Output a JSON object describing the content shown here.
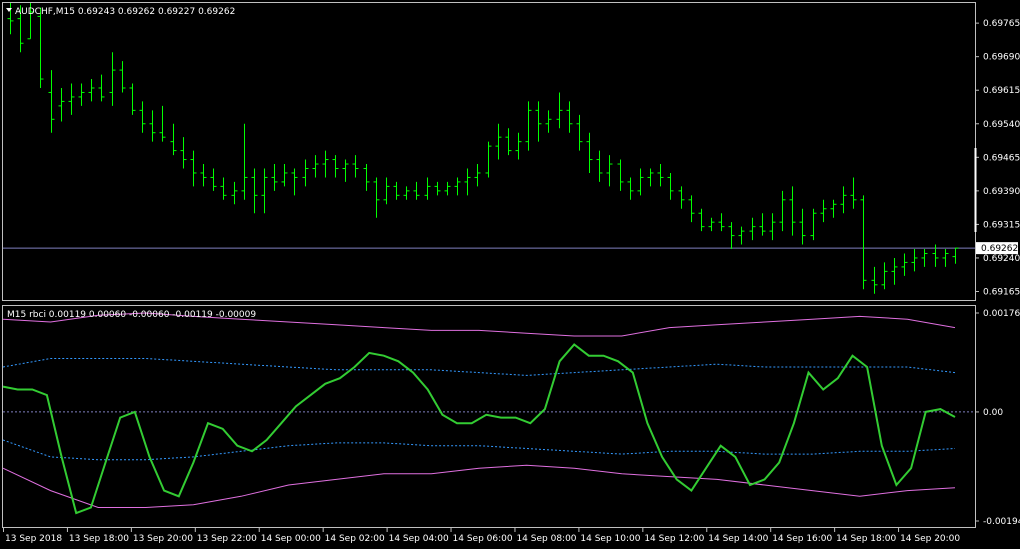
{
  "chart_data": [
    {
      "type": "ohlc",
      "title": "AUDCHF,M15  0.69243 0.69262 0.69227 0.69262",
      "symbol": "AUDCHF",
      "timeframe": "M15",
      "ohlc_header": [
        "0.69243",
        "0.69262",
        "0.69227",
        "0.69262"
      ],
      "ylim": [
        0.69146,
        0.6981
      ],
      "y_ticks": [
        "0.69765",
        "0.69690",
        "0.69615",
        "0.69540",
        "0.69465",
        "0.69390",
        "0.69315",
        "0.69240",
        "0.69165"
      ],
      "current_price": "0.69262",
      "current_price_value": 0.69262,
      "bar_color": "#00ff00",
      "price_line_color": "#8080c0",
      "bars": [
        [
          0.69775,
          0.6981,
          0.6974,
          0.6977
        ],
        [
          0.69775,
          0.69805,
          0.697,
          0.6972
        ],
        [
          0.6973,
          0.6981,
          0.6973,
          0.6979
        ],
        [
          0.6978,
          0.698,
          0.6962,
          0.6964
        ],
        [
          0.6961,
          0.6966,
          0.6952,
          0.6955
        ],
        [
          0.6958,
          0.6962,
          0.69545,
          0.6959
        ],
        [
          0.6959,
          0.6963,
          0.6956,
          0.696
        ],
        [
          0.696,
          0.6963,
          0.6958,
          0.6961
        ],
        [
          0.6961,
          0.6964,
          0.6959,
          0.6962
        ],
        [
          0.6962,
          0.6965,
          0.6959,
          0.696
        ],
        [
          0.6961,
          0.697,
          0.6958,
          0.6966
        ],
        [
          0.6966,
          0.6968,
          0.6961,
          0.6962
        ],
        [
          0.6962,
          0.6963,
          0.6956,
          0.6957
        ],
        [
          0.6957,
          0.6959,
          0.6952,
          0.6954
        ],
        [
          0.6954,
          0.6957,
          0.695,
          0.6952
        ],
        [
          0.6952,
          0.6958,
          0.695,
          0.6951
        ],
        [
          0.695,
          0.6954,
          0.6947,
          0.6948
        ],
        [
          0.6948,
          0.6951,
          0.6944,
          0.6946
        ],
        [
          0.6946,
          0.6948,
          0.694,
          0.6943
        ],
        [
          0.6943,
          0.6945,
          0.694,
          0.6942
        ],
        [
          0.6942,
          0.6944,
          0.6939,
          0.694
        ],
        [
          0.694,
          0.6942,
          0.6937,
          0.6938
        ],
        [
          0.6938,
          0.6941,
          0.6936,
          0.6939
        ],
        [
          0.6939,
          0.6954,
          0.6937,
          0.6942
        ],
        [
          0.6942,
          0.6944,
          0.6934,
          0.6938
        ],
        [
          0.6938,
          0.6944,
          0.6934,
          0.6942
        ],
        [
          0.6942,
          0.6945,
          0.6939,
          0.6941
        ],
        [
          0.6941,
          0.6945,
          0.694,
          0.6943
        ],
        [
          0.6943,
          0.6944,
          0.6938,
          0.6942
        ],
        [
          0.6942,
          0.6946,
          0.694,
          0.6944
        ],
        [
          0.6944,
          0.6947,
          0.6942,
          0.6945
        ],
        [
          0.6945,
          0.6948,
          0.6942,
          0.6946
        ],
        [
          0.6946,
          0.6947,
          0.6942,
          0.6944
        ],
        [
          0.6944,
          0.6946,
          0.6941,
          0.6945
        ],
        [
          0.6945,
          0.6947,
          0.6942,
          0.6944
        ],
        [
          0.6944,
          0.6945,
          0.6939,
          0.6941
        ],
        [
          0.6941,
          0.6942,
          0.6933,
          0.6937
        ],
        [
          0.6937,
          0.6942,
          0.6936,
          0.694
        ],
        [
          0.694,
          0.6941,
          0.6937,
          0.6938
        ],
        [
          0.6938,
          0.694,
          0.6937,
          0.6939
        ],
        [
          0.6939,
          0.6941,
          0.6937,
          0.6938
        ],
        [
          0.6938,
          0.6942,
          0.6937,
          0.694
        ],
        [
          0.694,
          0.6941,
          0.6938,
          0.6939
        ],
        [
          0.6939,
          0.6941,
          0.6938,
          0.694
        ],
        [
          0.694,
          0.6942,
          0.6938,
          0.6941
        ],
        [
          0.6941,
          0.6944,
          0.6938,
          0.6942
        ],
        [
          0.6942,
          0.6945,
          0.694,
          0.6943
        ],
        [
          0.6943,
          0.695,
          0.6942,
          0.6949
        ],
        [
          0.6949,
          0.6954,
          0.6946,
          0.6951
        ],
        [
          0.6951,
          0.6953,
          0.6947,
          0.6948
        ],
        [
          0.6948,
          0.6952,
          0.6946,
          0.695
        ],
        [
          0.695,
          0.6959,
          0.6948,
          0.6957
        ],
        [
          0.6957,
          0.6959,
          0.695,
          0.6954
        ],
        [
          0.6954,
          0.6957,
          0.6952,
          0.6955
        ],
        [
          0.6955,
          0.6961,
          0.6953,
          0.6957
        ],
        [
          0.6957,
          0.6959,
          0.6952,
          0.6954
        ],
        [
          0.6954,
          0.6956,
          0.6948,
          0.695
        ],
        [
          0.695,
          0.6952,
          0.6943,
          0.6946
        ],
        [
          0.6946,
          0.6948,
          0.6941,
          0.6943
        ],
        [
          0.6943,
          0.6947,
          0.694,
          0.6945
        ],
        [
          0.6945,
          0.6946,
          0.6939,
          0.6941
        ],
        [
          0.6941,
          0.6942,
          0.6937,
          0.6939
        ],
        [
          0.6939,
          0.6944,
          0.6938,
          0.6942
        ],
        [
          0.6942,
          0.6944,
          0.694,
          0.6943
        ],
        [
          0.6943,
          0.6945,
          0.694,
          0.6942
        ],
        [
          0.6942,
          0.6943,
          0.6937,
          0.6939
        ],
        [
          0.6939,
          0.694,
          0.6935,
          0.6937
        ],
        [
          0.6937,
          0.6938,
          0.6932,
          0.6934
        ],
        [
          0.6934,
          0.6935,
          0.693,
          0.6931
        ],
        [
          0.6931,
          0.6933,
          0.693,
          0.6932
        ],
        [
          0.6932,
          0.6934,
          0.693,
          0.6931
        ],
        [
          0.6931,
          0.6932,
          0.6926,
          0.6929
        ],
        [
          0.6929,
          0.6931,
          0.6927,
          0.693
        ],
        [
          0.693,
          0.6933,
          0.6928,
          0.6931
        ],
        [
          0.6931,
          0.6934,
          0.6929,
          0.693
        ],
        [
          0.693,
          0.6934,
          0.6928,
          0.6932
        ],
        [
          0.6932,
          0.6939,
          0.693,
          0.6937
        ],
        [
          0.6937,
          0.694,
          0.6929,
          0.6932
        ],
        [
          0.6932,
          0.6935,
          0.6927,
          0.6929
        ],
        [
          0.6929,
          0.6935,
          0.6928,
          0.6934
        ],
        [
          0.6934,
          0.6937,
          0.6932,
          0.6935
        ],
        [
          0.6935,
          0.6937,
          0.6933,
          0.6936
        ],
        [
          0.6936,
          0.694,
          0.6934,
          0.6938
        ],
        [
          0.6938,
          0.6942,
          0.6935,
          0.6937
        ],
        [
          0.6937,
          0.6938,
          0.6917,
          0.6919
        ],
        [
          0.6919,
          0.6922,
          0.6916,
          0.6918
        ],
        [
          0.6918,
          0.6923,
          0.6917,
          0.6921
        ],
        [
          0.6921,
          0.6924,
          0.6918,
          0.6922
        ],
        [
          0.6922,
          0.6925,
          0.692,
          0.6923
        ],
        [
          0.6923,
          0.6926,
          0.6921,
          0.6924
        ],
        [
          0.6924,
          0.6926,
          0.6922,
          0.6925
        ],
        [
          0.6925,
          0.6927,
          0.6922,
          0.6924
        ],
        [
          0.6924,
          0.6926,
          0.6922,
          0.6925
        ],
        [
          0.69243,
          0.69262,
          0.69227,
          0.69262
        ]
      ]
    },
    {
      "type": "line",
      "title": "M15 rbci 0.00119 0.00060 -0.00060 -0.00119 -0.00009",
      "indicator": "rbci",
      "header_values": [
        "0.00119",
        "0.00060",
        "-0.00060",
        "-0.00119",
        "-0.00009"
      ],
      "ylim": [
        -0.00194,
        0.00176
      ],
      "y_ticks": [
        "0.00176",
        "0.00",
        "-0.00194"
      ],
      "x_tick_labels": [
        "13 Sep 2018",
        "13 Sep 18:00",
        "13 Sep 20:00",
        "13 Sep 22:00",
        "14 Sep 00:00",
        "14 Sep 02:00",
        "14 Sep 04:00",
        "14 Sep 06:00",
        "14 Sep 08:00",
        "14 Sep 10:00",
        "14 Sep 12:00",
        "14 Sep 14:00",
        "14 Sep 16:00",
        "14 Sep 18:00",
        "14 Sep 20:00"
      ],
      "series": [
        {
          "name": "",
          "color": "#33cc33",
          "style": "solid",
          "values": [
            0.00045,
            0.0004,
            0.0004,
            0.0003,
            -0.0008,
            -0.0018,
            -0.0017,
            -0.0009,
            -0.0001,
            0.0,
            -0.0008,
            -0.0014,
            -0.0015,
            -0.0009,
            -0.0002,
            -0.0003,
            -0.0006,
            -0.0007,
            -0.0005,
            -0.0002,
            0.0001,
            0.0003,
            0.0005,
            0.0006,
            0.0008,
            0.00105,
            0.001,
            0.0009,
            0.0007,
            0.0004,
            -5e-05,
            -0.0002,
            -0.0002,
            -5e-05,
            -0.0001,
            -0.0001,
            -0.0002,
            5e-05,
            0.0009,
            0.0012,
            0.001,
            0.001,
            0.0009,
            0.0007,
            -0.0002,
            -0.0008,
            -0.0012,
            -0.0014,
            -0.001,
            -0.0006,
            -0.0008,
            -0.0013,
            -0.0012,
            -0.0009,
            -0.0002,
            0.0007,
            0.0004,
            0.0006,
            0.001,
            0.0008,
            -0.0006,
            -0.0013,
            -0.001,
            0.0,
            5e-05,
            -9e-05
          ]
        },
        {
          "name": "",
          "color": "#e070e0",
          "style": "solid",
          "values": [
            0.00165,
            0.0016,
            0.00172,
            0.00176,
            0.0017,
            0.00165,
            0.0016,
            0.00155,
            0.0015,
            0.00145,
            0.00145,
            0.0014,
            0.00135,
            0.00135,
            0.0015,
            0.00155,
            0.0016,
            0.00165,
            0.0017,
            0.00165,
            0.0015
          ]
        },
        {
          "name": "",
          "color": "#3399ff",
          "style": "dashed",
          "values": [
            0.0008,
            0.00095,
            0.00095,
            0.00095,
            0.0009,
            0.00085,
            0.0008,
            0.00075,
            0.00075,
            0.00075,
            0.0007,
            0.00065,
            0.0007,
            0.00075,
            0.0008,
            0.00085,
            0.0008,
            0.0008,
            0.0008,
            0.0008,
            0.0007
          ]
        },
        {
          "name": "",
          "color": "#3399ff",
          "style": "dashed",
          "values": [
            -0.0005,
            -0.0008,
            -0.00085,
            -0.00085,
            -0.0008,
            -0.0007,
            -0.0006,
            -0.00055,
            -0.00055,
            -0.0006,
            -0.0006,
            -0.00065,
            -0.0007,
            -0.00075,
            -0.0007,
            -0.0007,
            -0.00075,
            -0.00075,
            -0.0007,
            -0.0007,
            -0.00065
          ]
        },
        {
          "name": "",
          "color": "#e070e0",
          "style": "solid",
          "values": [
            -0.001,
            -0.0014,
            -0.0017,
            -0.0017,
            -0.00165,
            -0.0015,
            -0.0013,
            -0.0012,
            -0.0011,
            -0.0011,
            -0.001,
            -0.00095,
            -0.001,
            -0.0011,
            -0.00115,
            -0.0012,
            -0.0013,
            -0.0014,
            -0.0015,
            -0.0014,
            -0.00135
          ]
        },
        {
          "name": "",
          "color": "#8080c0",
          "style": "dashed",
          "values": [
            0.0,
            0.0
          ]
        }
      ]
    }
  ]
}
